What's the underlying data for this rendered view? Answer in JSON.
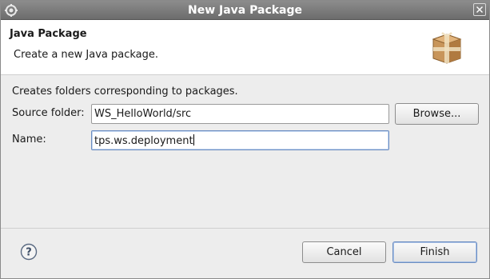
{
  "window": {
    "title": "New Java Package"
  },
  "banner": {
    "heading": "Java Package",
    "description": "Create a new Java package.",
    "icon": "package-icon"
  },
  "form": {
    "note": "Creates folders corresponding to packages.",
    "source_folder_label": "Source folder:",
    "source_folder_value": "WS_HelloWorld/src",
    "browse_label": "Browse...",
    "name_label": "Name:",
    "name_value": "tps.ws.deployment"
  },
  "footer": {
    "help_icon": "help-icon",
    "cancel_label": "Cancel",
    "finish_label": "Finish"
  },
  "colors": {
    "titlebar": "#7a7a7a",
    "focus_border": "#6b8dc1",
    "banner_bg": "#ffffff",
    "dialog_bg": "#ededed"
  }
}
